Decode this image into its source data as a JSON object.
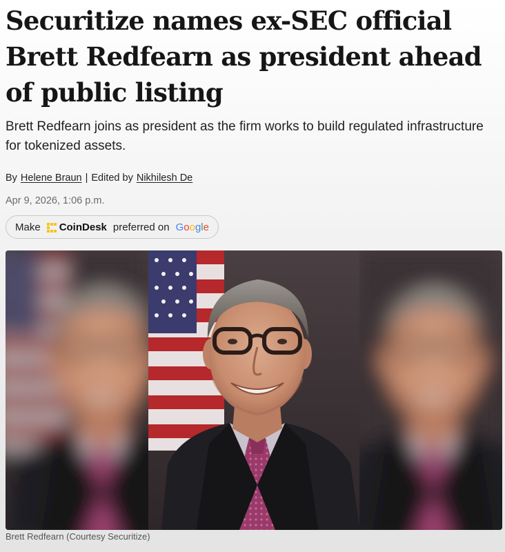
{
  "article": {
    "headline": "Securitize names ex-SEC official Brett Redfearn as president ahead of public listing",
    "subheadline": "Brett Redfearn joins as president as the firm works to build regulated infrastructure for tokenized assets.",
    "byline": {
      "prefix": "By",
      "author": "Helene Braun",
      "separator": "|",
      "edited_prefix": "Edited by",
      "editor": "Nikhilesh De"
    },
    "date": "Apr 9, 2026, 1:06 p.m.",
    "preferred_source": {
      "make": "Make",
      "brand": "CoinDesk",
      "preferred_on": "preferred on",
      "google_letters": [
        "G",
        "o",
        "o",
        "g",
        "l",
        "e"
      ],
      "icons": [
        "coindesk-logo-icon"
      ]
    },
    "image_caption": "Brett Redfearn (Courtesy Securitize)"
  },
  "colors": {
    "coindesk_yellow": "#f5c518",
    "google_blue": "#4285F4",
    "google_red": "#EA4335",
    "google_yellow": "#FBBC05",
    "google_green": "#34A853"
  }
}
